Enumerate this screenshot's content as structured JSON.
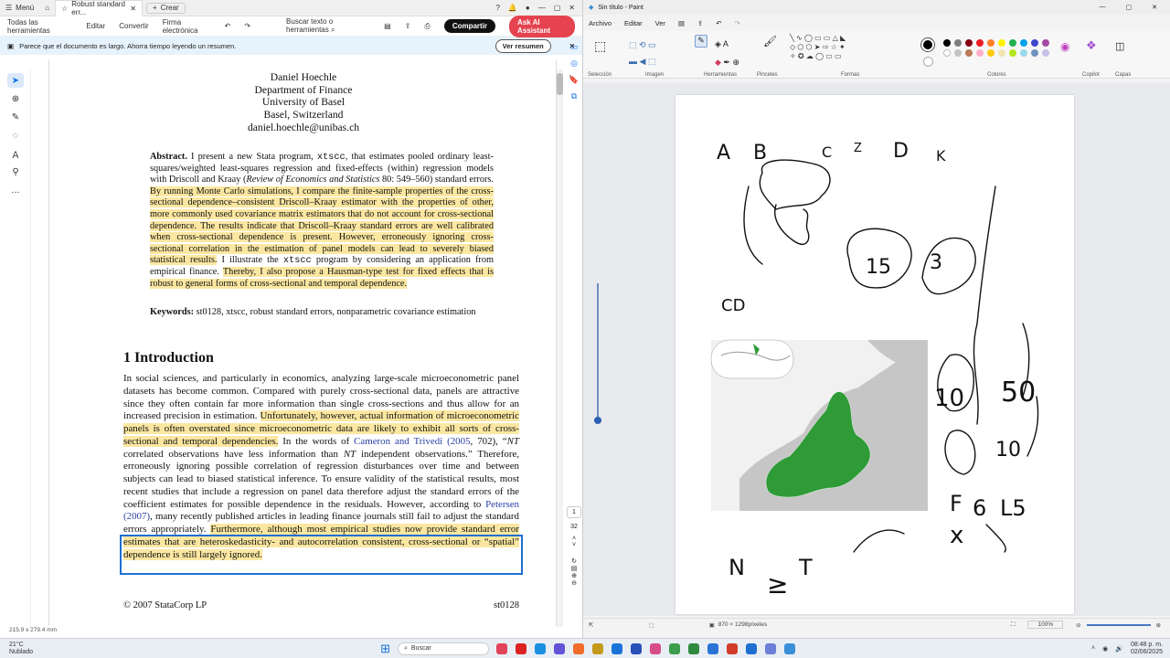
{
  "acrobat": {
    "tabs": {
      "menu": "Menú",
      "active_tab": "Robust standard err...",
      "new_tab": "Crear"
    },
    "toolbar": {
      "all_tools": "Todas las herramientas",
      "edit": "Editar",
      "convert": "Convertir",
      "esign": "Firma electrónica",
      "search": "Buscar texto o herramientas",
      "share": "Compartir",
      "ai": "Ask AI Assistant"
    },
    "banner": {
      "text": "Parece que el documento es largo. Ahorra tiempo leyendo un resumen.",
      "button": "Ver resumen"
    },
    "status": "215.9 x 279.4 mm",
    "page_numbers": {
      "current": "1",
      "total": "32"
    },
    "doc": {
      "author": [
        "Daniel Hoechle",
        "Department of Finance",
        "University of Basel",
        "Basel, Switzerland",
        "daniel.hoechle@unibas.ch"
      ],
      "abstract_label": "Abstract.",
      "abstract_plain1": " I present a new Stata program, ",
      "cmd": "xtscc",
      "abstract_plain2": ", that estimates pooled ordinary least-squares/weighted least-squares regression and fixed-effects (within) regression models with Driscoll and Kraay (",
      "journal": "Review of Economics and Statistics",
      "abstract_plain3": " 80: 549–560) standard errors. ",
      "abstract_hl1": "By running Monte Carlo simulations, I compare the finite-sample properties of the cross-sectional dependence–consistent Driscoll–Kraay estimator with the properties of other, more commonly used covariance matrix estimators that do not account for cross-sectional dependence. The results indicate that Driscoll–Kraay standard errors are well calibrated when cross-sectional dependence is present. However, erroneously ignoring cross-sectional correlation in the estimation of panel models can lead to severely biased statistical results.",
      "abstract_plain4": " I illustrate the ",
      "abstract_plain5": " program by considering an application from empirical finance. ",
      "abstract_hl2": "Thereby, I also propose a Hausman-type test for fixed effects that is robust to general forms of cross-sectional and temporal dependence.",
      "keywords_label": "Keywords:",
      "keywords": " st0128, xtscc, robust standard errors, nonparametric covariance estimation",
      "intro_heading": "1    Introduction",
      "intro_p1": "In social sciences, and particularly in economics, analyzing large-scale microeconometric panel datasets has become common. Compared with purely cross-sectional data, panels are attractive since they often contain far more information than single cross-sections and thus allow for an increased precision in estimation. ",
      "intro_hl1": "Unfortunately, however, actual information of microeconometric panels is often overstated since microeconometric data are likely to exhibit all sorts of cross-sectional and temporal dependencies.",
      "intro_p2": " In the words of ",
      "cite1": "Cameron and Trivedi (2005",
      "intro_p3": ", 702), “",
      "nt1": "NT",
      "intro_p4": " correlated observations have less information than ",
      "nt2": "NT",
      "intro_p5": " independent observations.” Therefore, erroneously ignoring possible correlation of regression disturbances over time and between subjects can lead to biased statistical inference. To ensure validity of the statistical results, most recent studies that include a regression on panel data therefore adjust the standard errors of the coefficient estimates for possible dependence in the residuals. However, according to ",
      "cite2": "Petersen (2007)",
      "intro_p6": ", many recently published articles in leading finance journals still fail to adjust the standard errors appropriately. ",
      "intro_hl2": "Furthermore, although most empirical studies now provide standard error estimates that are heteroskedasticity- and autocorrelation consistent, cross-sectional or “spatial” dependence is still largely ignored.",
      "footer_left": "© 2007 StataCorp LP",
      "footer_right": "st0128"
    }
  },
  "paint": {
    "title": "Sin título - Paint",
    "menu": [
      "Archivo",
      "Editar",
      "Ver"
    ],
    "groups": [
      "Selección",
      "Imagen",
      "Herramientas",
      "Pinceles",
      "Formas",
      "Colores",
      "Copilot",
      "Capas"
    ],
    "canvas_size": "870 × 1298píxeles",
    "zoom": "100%",
    "palette": [
      "#000000",
      "#7f7f7f",
      "#880015",
      "#ed1c24",
      "#ff7f27",
      "#fff200",
      "#22b14c",
      "#00a2e8",
      "#3f48cc",
      "#a349a4"
    ],
    "palette2": [
      "#ffffff",
      "#c3c3c3",
      "#b97a57",
      "#ffaec9",
      "#ffc90e",
      "#efe4b0",
      "#b5e61d",
      "#99d9ea",
      "#7092be",
      "#c8bfe7"
    ],
    "map_colors": {
      "sea": "#f4f4f4",
      "land": "#c6c6c6",
      "eu": "#2e9b36"
    },
    "handwriting": {
      "a": "A",
      "b": "B",
      "c": "C",
      "z": "Z",
      "d": "D",
      "k": "K",
      "n15": "15",
      "n3": "3",
      "n10a": "10",
      "n50": "50",
      "n10b": "10",
      "f": "F",
      "g": "6",
      "l": "L5",
      "n": "N",
      "t": "T",
      "cd": "CD",
      "ineq": "≥",
      "gt": ">",
      "x": "x"
    }
  },
  "taskbar": {
    "weather_temp": "21°C",
    "weather_desc": "Nublado",
    "search": "Buscar",
    "time": "08:48 p. m.",
    "date": "02/06/2025"
  }
}
